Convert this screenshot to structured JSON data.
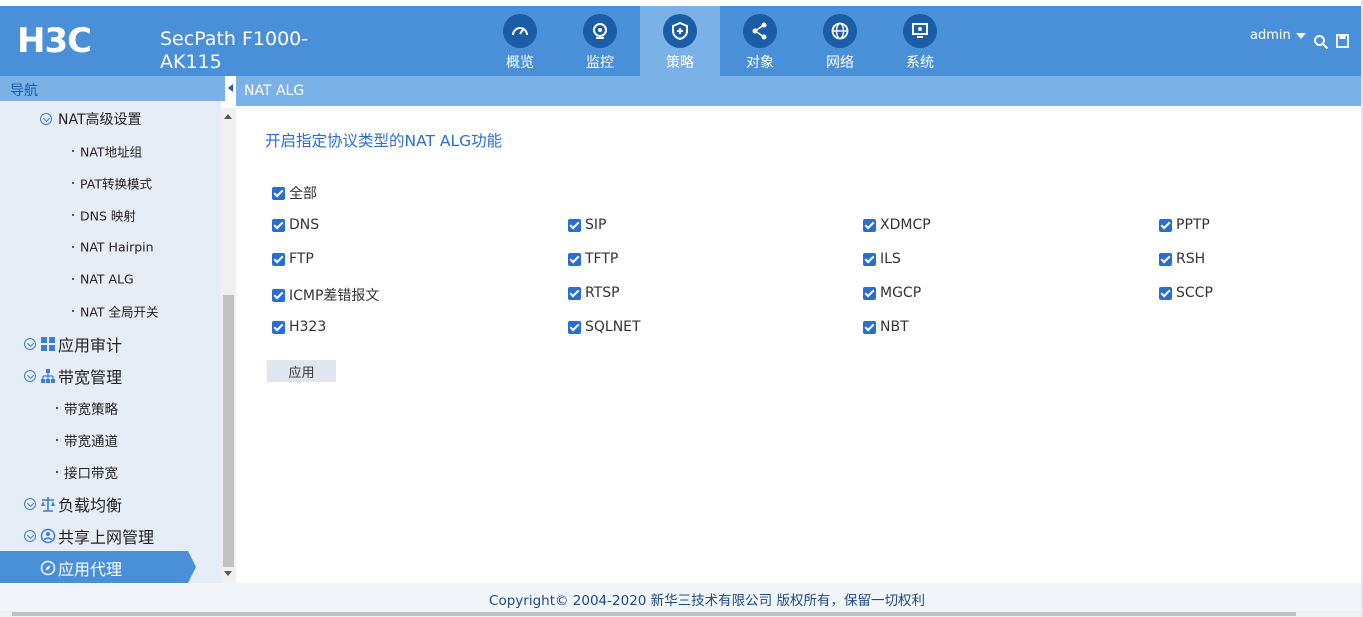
{
  "header": {
    "brand_logo_text": "H3C",
    "product_line1": "SecPath F1000-",
    "product_line2": "AK115",
    "tabs": [
      {
        "label": "概览",
        "icon": "dashboard-icon"
      },
      {
        "label": "监控",
        "icon": "monitor-camera-icon"
      },
      {
        "label": "策略",
        "icon": "shield-icon",
        "active": true
      },
      {
        "label": "对象",
        "icon": "share-icon"
      },
      {
        "label": "网络",
        "icon": "globe-icon"
      },
      {
        "label": "系统",
        "icon": "system-screen-icon"
      }
    ],
    "user": "admin",
    "icons": [
      "caret-down-icon",
      "search-icon",
      "save-icon"
    ]
  },
  "nav": {
    "title": "导航",
    "items": [
      {
        "label": "NAT高级设置",
        "level": 2,
        "expanded": true
      },
      {
        "label": "NAT地址组",
        "level": 3
      },
      {
        "label": "PAT转换模式",
        "level": 3
      },
      {
        "label": "DNS 映射",
        "level": 3
      },
      {
        "label": "NAT Hairpin",
        "level": 3
      },
      {
        "label": "NAT ALG",
        "level": 3,
        "selected": true
      },
      {
        "label": "NAT 全局开关",
        "level": 3
      },
      {
        "label": "应用审计",
        "level": 1,
        "icon": "grid-icon"
      },
      {
        "label": "带宽管理",
        "level": 1,
        "icon": "hierarchy-icon"
      },
      {
        "label": "带宽策略",
        "level": 3
      },
      {
        "label": "带宽通道",
        "level": 3
      },
      {
        "label": "接口带宽",
        "level": 3
      },
      {
        "label": "负载均衡",
        "level": 1,
        "icon": "balance-icon"
      },
      {
        "label": "共享上网管理",
        "level": 1,
        "icon": "users-share-icon"
      },
      {
        "label": "应用代理",
        "level": 1,
        "icon": "compass-icon",
        "active": true
      }
    ]
  },
  "breadcrumb": "NAT ALG",
  "main": {
    "heading": "开启指定协议类型的NAT ALG功能",
    "all_label": "全部",
    "protocols": [
      [
        "DNS",
        "SIP",
        "XDMCP",
        "PPTP"
      ],
      [
        "FTP",
        "TFTP",
        "ILS",
        "RSH"
      ],
      [
        "ICMP差错报文",
        "RTSP",
        "MGCP",
        "SCCP"
      ],
      [
        "H323",
        "SQLNET",
        "NBT"
      ]
    ],
    "apply_label": "应用"
  },
  "footer": {
    "copyright": "Copyright© 2004-2020 新华三技术有限公司 版权所有，保留一切权利"
  },
  "colors": {
    "primary": "#4a90d9",
    "nav_dark": "#1a5da6",
    "light_blue": "#7ab2e8",
    "checkbox": "#2a6fd0",
    "sidebar_bg": "#e7edf7"
  }
}
